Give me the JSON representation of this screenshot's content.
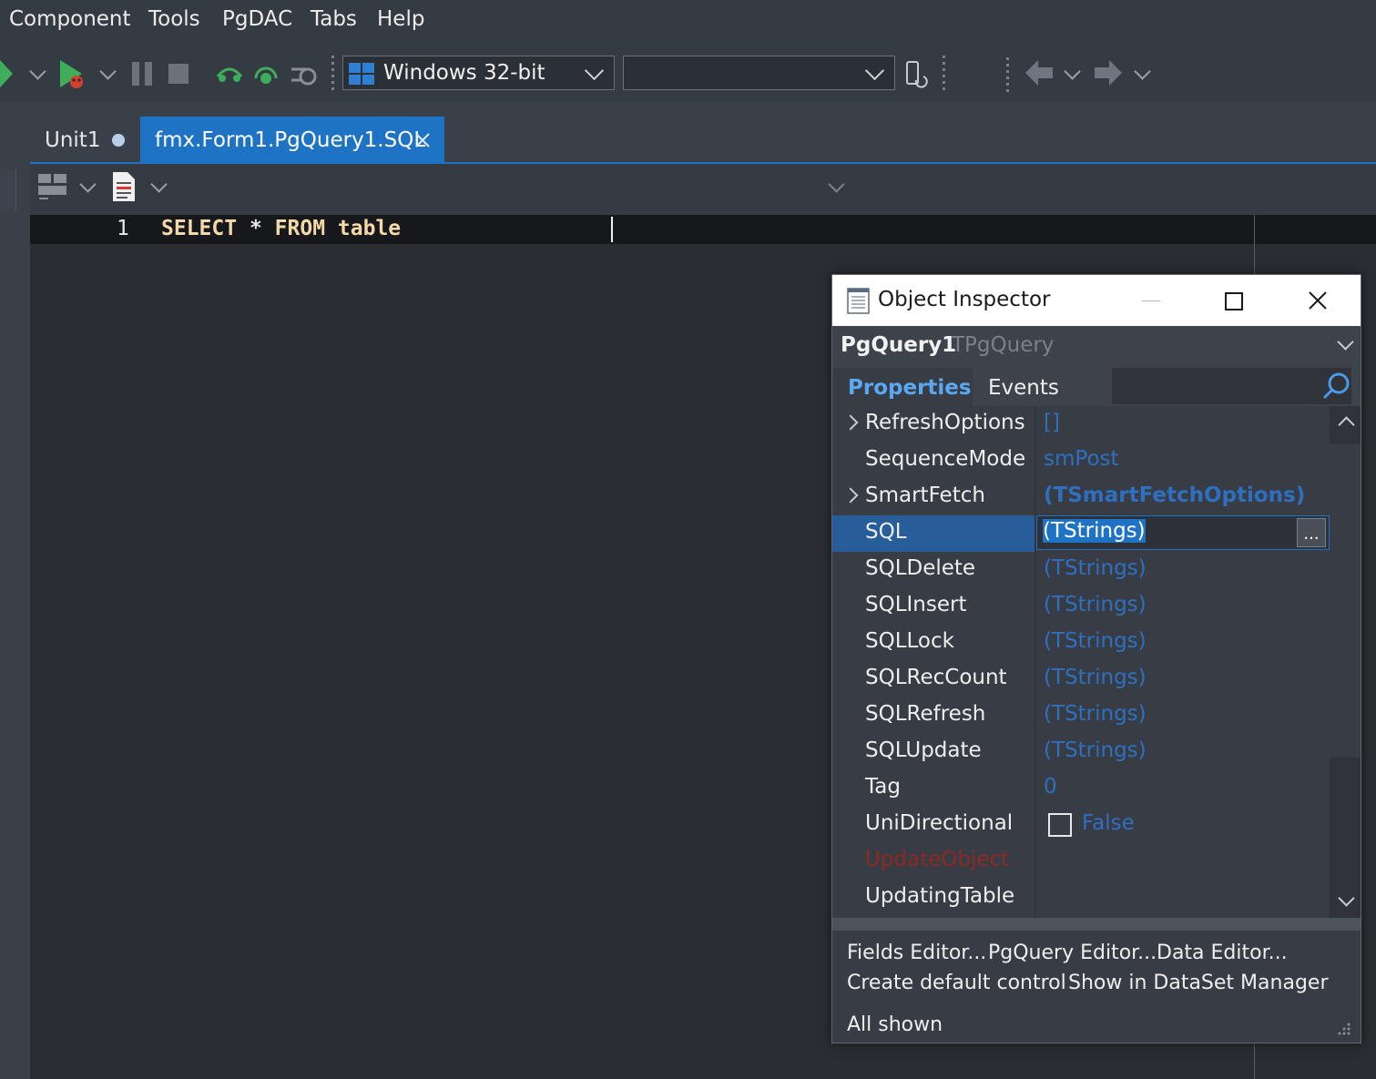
{
  "menu": [
    "Component",
    "Tools",
    "PgDAC",
    "Tabs",
    "Help"
  ],
  "toolbar": {
    "platform": "Windows 32-bit",
    "config": ""
  },
  "tabs": [
    {
      "label": "Unit1",
      "modified": true,
      "active": false
    },
    {
      "label": "fmx.Form1.PgQuery1.SQL",
      "modified": false,
      "active": true
    }
  ],
  "editor": {
    "line_number": "1",
    "code_keyword1": "SELECT",
    "code_star": "*",
    "code_keyword2": "FROM",
    "code_ident": "table"
  },
  "inspector": {
    "title": "Object Inspector",
    "object_name": "PgQuery1",
    "object_type": "TPgQuery",
    "tab_properties": "Properties",
    "tab_events": "Events",
    "rows": [
      {
        "name": "RefreshOptions",
        "value": "[]",
        "expand": true
      },
      {
        "name": "SequenceMode",
        "value": "smPost",
        "expand": false
      },
      {
        "name": "SmartFetch",
        "value": "(TSmartFetchOptions)",
        "expand": true
      },
      {
        "name": "SQL",
        "value": "(TStrings)",
        "expand": false
      },
      {
        "name": "SQLDelete",
        "value": "(TStrings)",
        "expand": false
      },
      {
        "name": "SQLInsert",
        "value": "(TStrings)",
        "expand": false
      },
      {
        "name": "SQLLock",
        "value": "(TStrings)",
        "expand": false
      },
      {
        "name": "SQLRecCount",
        "value": "(TStrings)",
        "expand": false
      },
      {
        "name": "SQLRefresh",
        "value": "(TStrings)",
        "expand": false
      },
      {
        "name": "SQLUpdate",
        "value": "(TStrings)",
        "expand": false
      },
      {
        "name": "Tag",
        "value": "0",
        "expand": false
      },
      {
        "name": "UniDirectional",
        "value": "False",
        "expand": false
      },
      {
        "name": "UpdateObject",
        "value": "",
        "expand": false
      },
      {
        "name": "UpdatingTable",
        "value": "",
        "expand": false
      }
    ],
    "ellipsis": "...",
    "footer_links": [
      "Fields Editor...",
      "PgQuery Editor...",
      "Data Editor...",
      "Create default control",
      "Show in DataSet Manager"
    ],
    "status": "All shown"
  },
  "colors": {
    "accent": "#1e73c4",
    "value_blue": "#2f6fbf",
    "selected_row": "#275e99",
    "keyword": "#f3d9a8",
    "property_red": "#8c2a22",
    "properties_tab": "#5aa8f0"
  }
}
